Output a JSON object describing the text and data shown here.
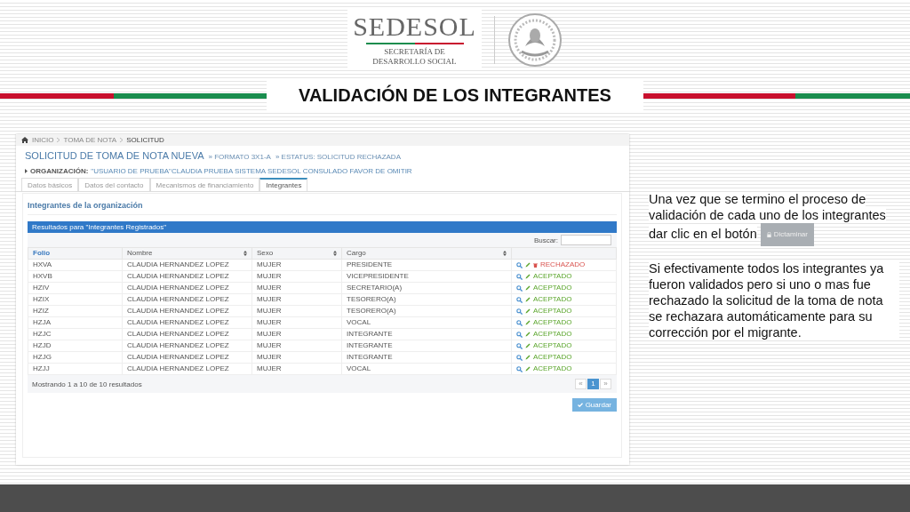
{
  "logo": {
    "name": "SEDESOL",
    "subtitle": "SECRETARÍA DE\nDESARROLLO SOCIAL"
  },
  "slide_title": "VALIDACIÓN DE LOS INTEGRANTES",
  "app": {
    "breadcrumb": [
      "INICIO",
      "TOMA DE NOTA",
      "SOLICITUD"
    ],
    "page_title": "SOLICITUD DE TOMA DE NOTA NUEVA",
    "format": "» FORMATO 3X1-A",
    "status": "» ESTATUS: SOLICITUD RECHAZADA",
    "organization_label": "ORGANIZACIÓN:",
    "organization_value": "\"USUARIO DE PRUEBA\"CLAUDIA PRUEBA SISTEMA SEDESOL CONSULADO FAVOR DE OMITIR",
    "tabs": [
      {
        "label": "Datos básicos",
        "selected": false
      },
      {
        "label": "Datos del contacto",
        "selected": false
      },
      {
        "label": "Mecanismos de financiamiento",
        "selected": false
      },
      {
        "label": "Integrantes",
        "selected": true
      }
    ],
    "section_title": "Integrantes de la organización",
    "results_header": "Resultados para \"Integrantes Registrados\"",
    "search_label": "Buscar:",
    "columns": [
      {
        "label": "Folio",
        "sorted": true
      },
      {
        "label": "Nombre",
        "sorted": false
      },
      {
        "label": "Sexo",
        "sorted": false
      },
      {
        "label": "Cargo",
        "sorted": false
      }
    ],
    "rows": [
      {
        "folio": "HXVA",
        "nombre": "CLAUDIA HERNANDEZ LOPEZ",
        "sexo": "MUJER",
        "cargo": "PRESIDENTE",
        "status": "RECHAZADO",
        "kind": "rejected"
      },
      {
        "folio": "HXVB",
        "nombre": "CLAUDIA HERNANDEZ LOPEZ",
        "sexo": "MUJER",
        "cargo": "VICEPRESIDENTE",
        "status": "ACEPTADO",
        "kind": "accepted"
      },
      {
        "folio": "HZIV",
        "nombre": "CLAUDIA HERNANDEZ LOPEZ",
        "sexo": "MUJER",
        "cargo": "SECRETARIO(A)",
        "status": "ACEPTADO",
        "kind": "accepted"
      },
      {
        "folio": "HZIX",
        "nombre": "CLAUDIA HERNANDEZ LOPEZ",
        "sexo": "MUJER",
        "cargo": "TESORERO(A)",
        "status": "ACEPTADO",
        "kind": "accepted"
      },
      {
        "folio": "HZIZ",
        "nombre": "CLAUDIA HERNANDEZ LOPEZ",
        "sexo": "MUJER",
        "cargo": "TESORERO(A)",
        "status": "ACEPTADO",
        "kind": "accepted"
      },
      {
        "folio": "HZJA",
        "nombre": "CLAUDIA HERNANDEZ LOPEZ",
        "sexo": "MUJER",
        "cargo": "VOCAL",
        "status": "ACEPTADO",
        "kind": "accepted"
      },
      {
        "folio": "HZJC",
        "nombre": "CLAUDIA HERNANDEZ LOPEZ",
        "sexo": "MUJER",
        "cargo": "INTEGRANTE",
        "status": "ACEPTADO",
        "kind": "accepted"
      },
      {
        "folio": "HZJD",
        "nombre": "CLAUDIA HERNANDEZ LOPEZ",
        "sexo": "MUJER",
        "cargo": "INTEGRANTE",
        "status": "ACEPTADO",
        "kind": "accepted"
      },
      {
        "folio": "HZJG",
        "nombre": "CLAUDIA HERNANDEZ LOPEZ",
        "sexo": "MUJER",
        "cargo": "INTEGRANTE",
        "status": "ACEPTADO",
        "kind": "accepted"
      },
      {
        "folio": "HZJJ",
        "nombre": "CLAUDIA HERNANDEZ LOPEZ",
        "sexo": "MUJER",
        "cargo": "VOCAL",
        "status": "ACEPTADO",
        "kind": "accepted"
      }
    ],
    "footer": "Mostrando 1 a 10 de 10 resultados",
    "pagination": [
      {
        "label": "«",
        "selected": false
      },
      {
        "label": "1",
        "selected": true
      },
      {
        "label": "»",
        "selected": false
      }
    ],
    "save_button": "Guardar"
  },
  "notes": {
    "paragraph_1": "Una vez que se termino el proceso de validación de cada uno de los integrantes dar clic en el botón",
    "inline_button": "Dictaminar",
    "paragraph_2": "Si efectivamente todos los integrantes ya fueron validados pero si uno o mas fue rechazado la solicitud de la toma de nota se rechazara automáticamente para su corrección por el migrante."
  }
}
